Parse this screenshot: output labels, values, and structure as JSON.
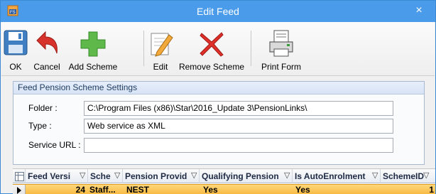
{
  "window": {
    "title": "Edit Feed",
    "close_glyph": "×"
  },
  "toolbar": {
    "ok": "OK",
    "cancel": "Cancel",
    "add_scheme": "Add Scheme",
    "edit": "Edit",
    "remove_scheme": "Remove Scheme",
    "print_form": "Print Form"
  },
  "settings": {
    "title": "Feed Pension Scheme Settings",
    "folder_label": "Folder :",
    "folder_value": "C:\\Program Files (x86)\\Star\\2016_Update 3\\PensionLinks\\",
    "type_label": "Type :",
    "type_value": "Web service as XML",
    "service_url_label": "Service URL :",
    "service_url_value": ""
  },
  "grid": {
    "columns": [
      "Feed Versi",
      "Sche",
      "Pension Provid",
      "Qualifying Pension",
      "Is AutoEnrolment",
      "SchemeID"
    ],
    "rows": [
      {
        "feed_version": "24",
        "scheme": "Staff...",
        "pension_provider": "NEST",
        "qualifying_pension": "Yes",
        "is_autoenrolment": "Yes",
        "scheme_id": "1"
      }
    ]
  },
  "colors": {
    "titlebar": "#4a9bea",
    "selected_row": "#f7b53c",
    "group_header": "#d7e3f5"
  },
  "icons": [
    "app-icon",
    "save-icon",
    "undo-arrow-icon",
    "plus-icon",
    "pencil-icon",
    "red-x-icon",
    "print-form-icon",
    "grid-options-icon",
    "filter-icon",
    "row-pointer-icon"
  ]
}
